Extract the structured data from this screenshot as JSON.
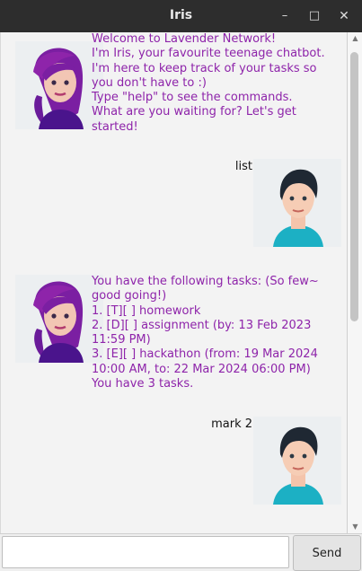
{
  "window": {
    "title": "Iris"
  },
  "controls": {
    "minimize": "–",
    "maximize": "□",
    "close": "✕"
  },
  "colors": {
    "iris_text": "#8e24aa",
    "user_text": "#111111",
    "titlebar_bg": "#2d2d2d"
  },
  "messages": [
    {
      "sender": "iris",
      "text": "Welcome to Lavender Network!\nI'm Iris, your favourite teenage chatbot.\nI'm here to keep track of your tasks so you don't have to :)\nType \"help\" to see the commands.\nWhat are you waiting for? Let's get started!"
    },
    {
      "sender": "user",
      "text": "list"
    },
    {
      "sender": "iris",
      "text": "You have the following tasks: (So few~ good going!)\n1. [T][ ] homework\n2. [D][ ] assignment (by: 13 Feb 2023 11:59 PM)\n3. [E][ ] hackathon (from: 19 Mar 2024 10:00 AM, to: 22 Mar 2024 06:00 PM)\nYou have 3 tasks."
    },
    {
      "sender": "user",
      "text": "mark 2"
    }
  ],
  "input": {
    "value": "",
    "placeholder": ""
  },
  "send_button": {
    "label": "Send"
  },
  "scrollbar": {
    "up_icon": "▲",
    "down_icon": "▼"
  }
}
